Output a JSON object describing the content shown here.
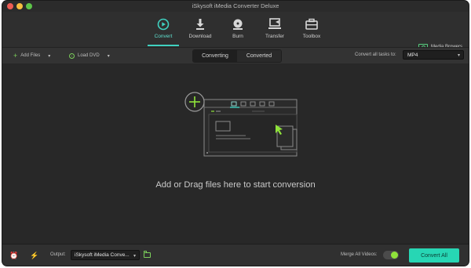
{
  "window": {
    "title": "iSkysoft iMedia Converter Deluxe"
  },
  "nav": {
    "items": [
      {
        "label": "Convert",
        "icon": "convert-icon",
        "active": true
      },
      {
        "label": "Download",
        "icon": "download-icon",
        "active": false
      },
      {
        "label": "Burn",
        "icon": "burn-icon",
        "active": false
      },
      {
        "label": "Transfer",
        "icon": "transfer-icon",
        "active": false
      },
      {
        "label": "Toolbox",
        "icon": "toolbox-icon",
        "active": false
      }
    ],
    "media_browser_label": "Media Browers"
  },
  "toolbar": {
    "add_files_label": "Add Files",
    "load_dvd_label": "Load DVD",
    "tabs": [
      {
        "label": "Converting",
        "active": true
      },
      {
        "label": "Converted",
        "active": false
      }
    ],
    "convert_all_tasks_label": "Convert all tasks to:",
    "format_value": "MP4"
  },
  "main": {
    "drop_text": "Add or Drag files here to start conversion"
  },
  "bottom": {
    "output_label": "Output:",
    "output_value": "iSkysoft iMedia Conve...",
    "merge_label": "Merge All Videos:",
    "merge_on": true,
    "convert_all_label": "Convert All"
  },
  "colors": {
    "accent": "#27d6b4",
    "active_nav": "#5fe0cf",
    "green_icon": "#7cd05b"
  }
}
